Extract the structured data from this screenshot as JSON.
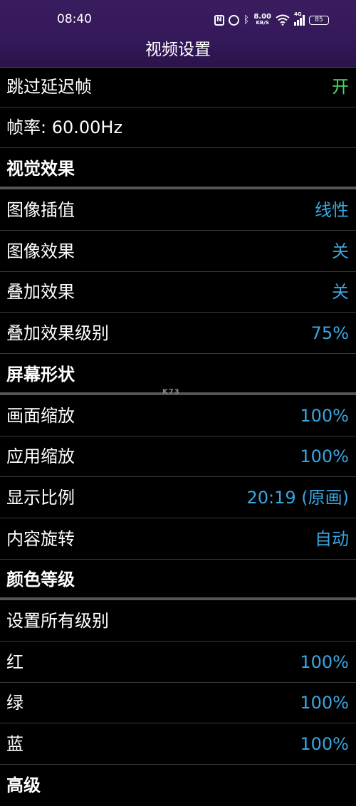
{
  "status_bar": {
    "time": "08:40",
    "net_speed_value": "8.00",
    "net_speed_unit": "KB/S",
    "signal_label": "4G",
    "battery": "85",
    "icons": [
      "nfc-icon",
      "alarm-icon",
      "bluetooth-icon",
      "wifi-icon",
      "signal-icon",
      "battery-icon"
    ]
  },
  "header": {
    "title": "视频设置"
  },
  "settings": [
    {
      "label": "跳过延迟帧",
      "value": "开",
      "kind": "toggle"
    },
    {
      "label": "帧率: 60.00Hz",
      "value": "",
      "kind": "info"
    },
    {
      "label": "视觉效果",
      "value": "",
      "kind": "section"
    },
    {
      "label": "图像插值",
      "value": "线性",
      "kind": "option"
    },
    {
      "label": "图像效果",
      "value": "关",
      "kind": "option"
    },
    {
      "label": "叠加效果",
      "value": "关",
      "kind": "option"
    },
    {
      "label": "叠加效果级别",
      "value": "75%",
      "kind": "option"
    },
    {
      "label": "屏幕形状",
      "value": "",
      "kind": "section"
    },
    {
      "label": "画面缩放",
      "value": "100%",
      "kind": "option"
    },
    {
      "label": "应用缩放",
      "value": "100%",
      "kind": "option"
    },
    {
      "label": "显示比例",
      "value": "20:19 (原画)",
      "kind": "option"
    },
    {
      "label": "内容旋转",
      "value": "自动",
      "kind": "option"
    },
    {
      "label": "颜色等级",
      "value": "",
      "kind": "section"
    },
    {
      "label": "设置所有级别",
      "value": "",
      "kind": "option"
    },
    {
      "label": "红",
      "value": "100%",
      "kind": "option"
    },
    {
      "label": "绿",
      "value": "100%",
      "kind": "option"
    },
    {
      "label": "蓝",
      "value": "100%",
      "kind": "option"
    },
    {
      "label": "高级",
      "value": "",
      "kind": "section"
    }
  ],
  "watermark": "K73",
  "colors": {
    "accent": "#3aa6e0",
    "on": "#4cd964",
    "header": "#35195a"
  }
}
